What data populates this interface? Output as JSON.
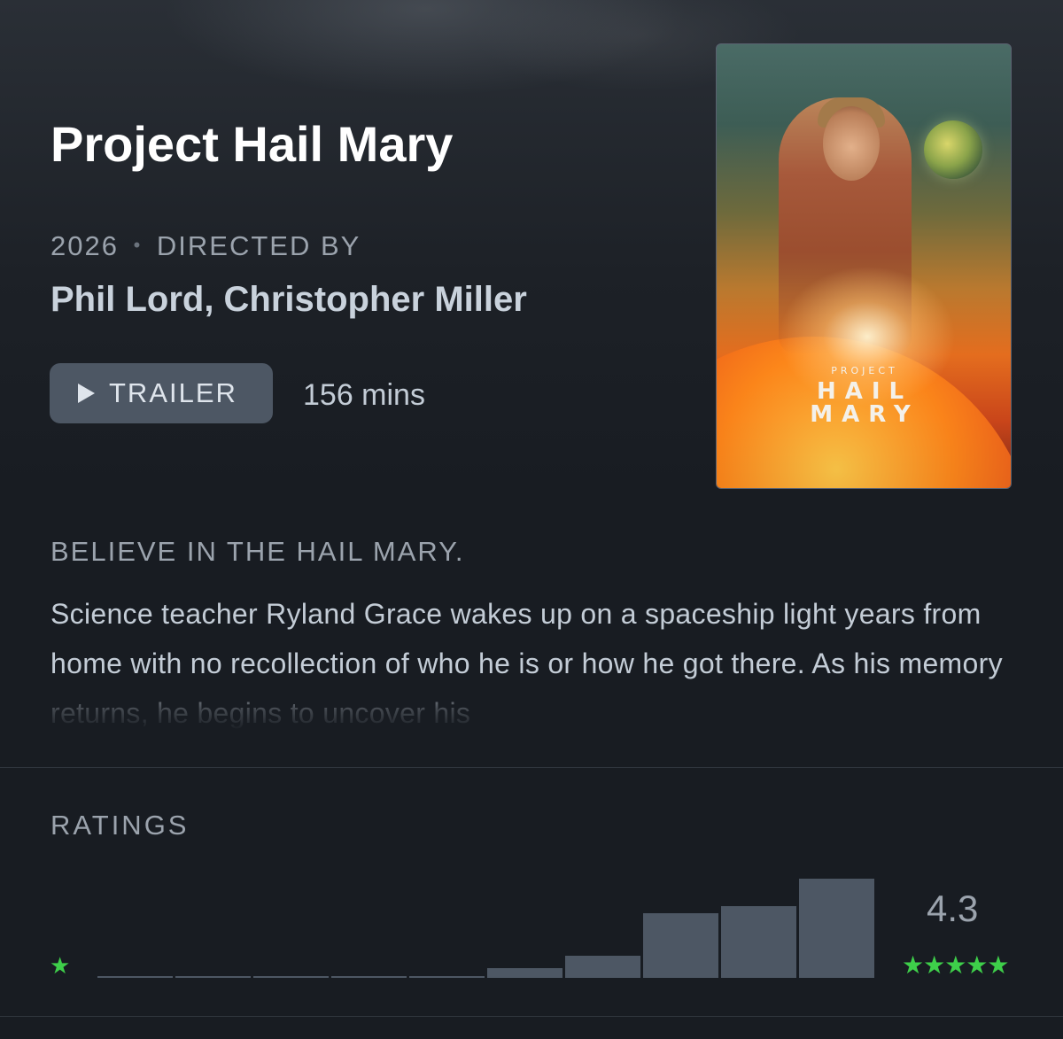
{
  "movie": {
    "title": "Project Hail Mary",
    "year": "2026",
    "separator": "•",
    "directed_by_label": "DIRECTED BY",
    "directors": "Phil Lord, Christopher Miller",
    "trailer_label": "TRAILER",
    "runtime": "156 mins",
    "tagline": "BELIEVE IN THE HAIL MARY.",
    "synopsis": "Science teacher Ryland Grace wakes up on a spaceship light years from home with no recollection of who he is or how he got there. As his memory returns, he begins to uncover his"
  },
  "poster": {
    "line_small": "PROJECT",
    "line_1": "HAIL",
    "line_2": "MARY"
  },
  "ratings": {
    "label": "RATINGS",
    "average": "4.3",
    "min_star": "★",
    "max_stars": "★★★★★",
    "star_color": "#3ecf4a",
    "bar_color": "#4d5764",
    "histogram": [
      0.02,
      0.02,
      0.02,
      0.02,
      0.02,
      0.1,
      0.22,
      0.65,
      0.72,
      1.0
    ]
  }
}
